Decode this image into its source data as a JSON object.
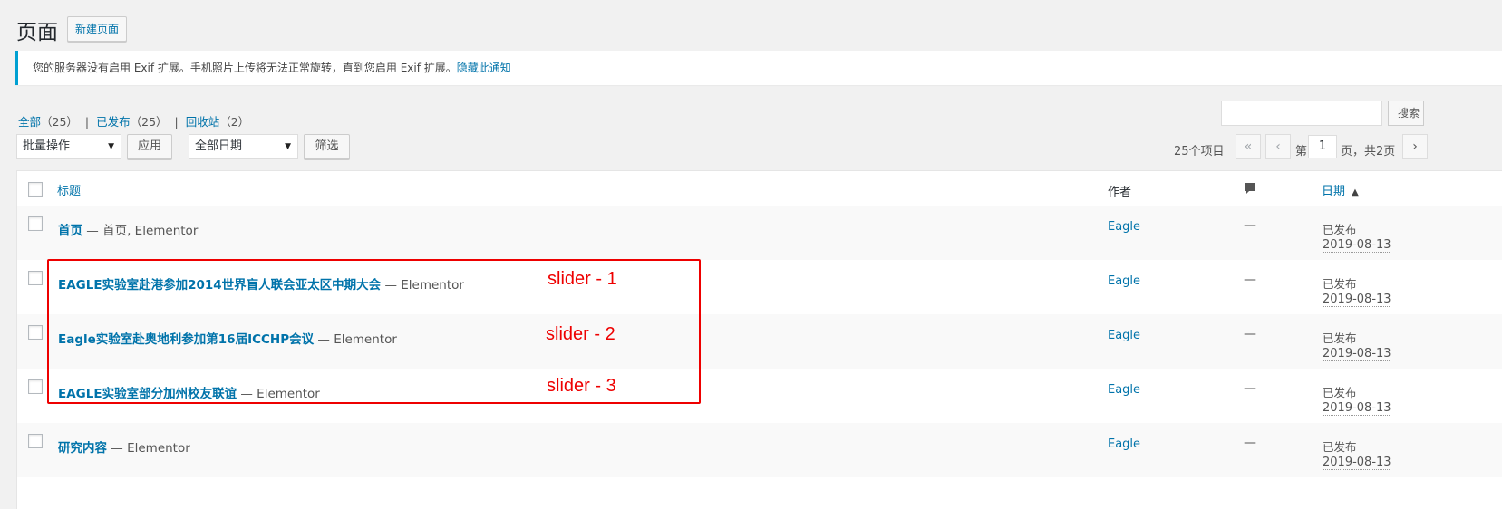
{
  "header": {
    "title": "页面",
    "add_new": "新建页面"
  },
  "notice": {
    "text": "您的服务器没有启用 Exif 扩展。手机照片上传将无法正常旋转，直到您启用 Exif 扩展。",
    "dismiss": "隐藏此通知"
  },
  "filters": {
    "all": "全部",
    "all_count": "（25）",
    "published": "已发布",
    "published_count": "（25）",
    "trash": "回收站",
    "trash_count": "（2）",
    "separator": "|"
  },
  "search": {
    "button": "搜索"
  },
  "bulk": {
    "select": "批量操作",
    "apply": "应用"
  },
  "dates": {
    "select": "全部日期",
    "filter": "筛选"
  },
  "pagination": {
    "items": "25个项目",
    "first": "«",
    "prev": "‹",
    "prefix": "第",
    "current": "1",
    "suffix": "页，共2页",
    "next": "›"
  },
  "table": {
    "columns": {
      "title": "标题",
      "author": "作者",
      "date": "日期",
      "sort": "▲"
    },
    "rows": [
      {
        "title": "首页",
        "suffix": " — 首页, Elementor",
        "author": "Eagle",
        "comments": "—",
        "status": "已发布",
        "date": "2019-08-13"
      },
      {
        "title": "EAGLE实验室赴港参加2014世界盲人联会亚太区中期大会",
        "suffix": " — Elementor",
        "author": "Eagle",
        "comments": "—",
        "status": "已发布",
        "date": "2019-08-13"
      },
      {
        "title": "Eagle实验室赴奥地利参加第16届ICCHP会议",
        "suffix": " — Elementor",
        "author": "Eagle",
        "comments": "—",
        "status": "已发布",
        "date": "2019-08-13"
      },
      {
        "title": "EAGLE实验室部分加州校友联谊",
        "suffix": " — Elementor",
        "author": "Eagle",
        "comments": "—",
        "status": "已发布",
        "date": "2019-08-13"
      },
      {
        "title": "研究内容",
        "suffix": " — Elementor",
        "author": "Eagle",
        "comments": "—",
        "status": "已发布",
        "date": "2019-08-13"
      }
    ]
  },
  "annotations": [
    "slider - 1",
    "slider - 2",
    "slider - 3"
  ],
  "colors": {
    "link": "#0073aa",
    "annotation": "#e00000",
    "notice_border": "#00a0d2"
  }
}
